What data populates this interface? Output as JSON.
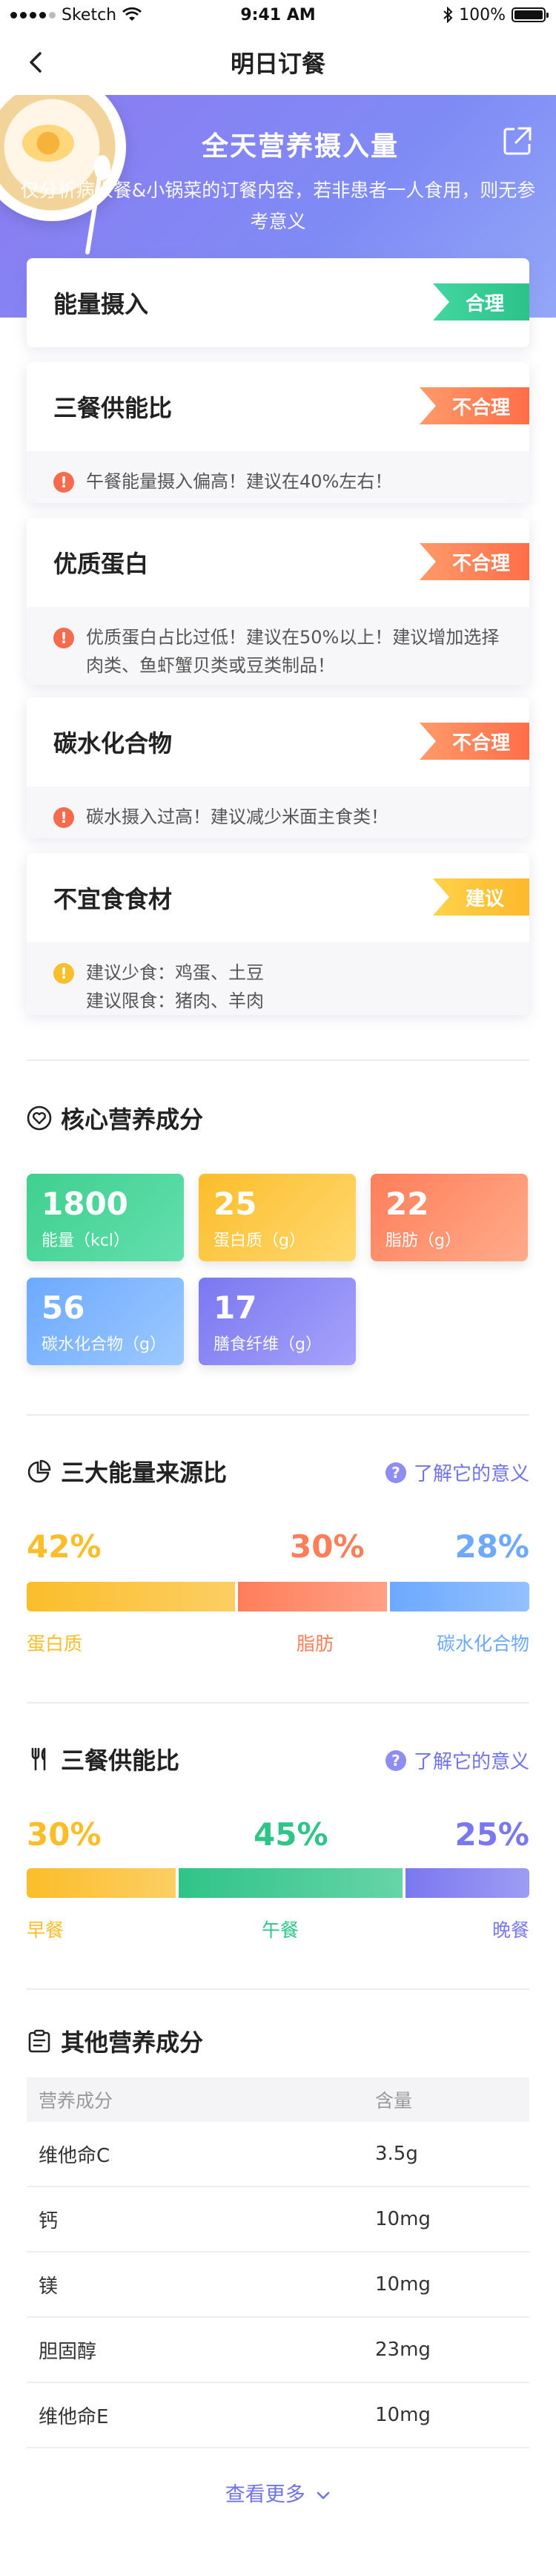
{
  "status_bar": {
    "carrier": "Sketch",
    "time": "9:41 AM",
    "battery": "100%",
    "battery_level": 1.0
  },
  "nav": {
    "title": "明日订餐"
  },
  "hero": {
    "title": "全天营养摄入量",
    "subtitle": "仅分析病人餐&小锅菜的订餐内容，若非患者一人食用，则无参考意义"
  },
  "evaluations": [
    {
      "title": "能量摄入",
      "tag": "合理",
      "tag_color": "green"
    },
    {
      "title": "三餐供能比",
      "tag": "不合理",
      "tag_color": "orange",
      "note": "午餐能量摄入偏高！建议在40%左右！"
    },
    {
      "title": "优质蛋白",
      "tag": "不合理",
      "tag_color": "orange",
      "note": "优质蛋白占比过低！建议在50%以上！建议增加选择肉类、鱼虾蟹贝类或豆类制品！"
    },
    {
      "title": "碳水化合物",
      "tag": "不合理",
      "tag_color": "orange",
      "note": "碳水摄入过高！建议减少米面主食类！"
    },
    {
      "title": "不宜食食材",
      "tag": "建议",
      "tag_color": "yellow",
      "note_lines": [
        "建议少食：鸡蛋、土豆",
        "建议限食：猪肉、羊肉"
      ]
    }
  ],
  "core": {
    "title": "核心营养成分",
    "tiles": [
      {
        "value": "1800",
        "label": "能量（kcl）",
        "color": "green"
      },
      {
        "value": "25",
        "label": "蛋白质（g）",
        "color": "yellow"
      },
      {
        "value": "22",
        "label": "脂肪（g）",
        "color": "orange"
      },
      {
        "value": "56",
        "label": "碳水化合物（g）",
        "color": "blue"
      },
      {
        "value": "17",
        "label": "膳食纤维（g）",
        "color": "purple"
      }
    ]
  },
  "energy_source": {
    "title": "三大能量来源比",
    "link": "了解它的意义",
    "items": [
      {
        "pct": "42%",
        "value": 42,
        "label": "蛋白质",
        "color": "#fbbd2a"
      },
      {
        "pct": "30%",
        "value": 30,
        "label": "脂肪",
        "color": "#ff7e5a"
      },
      {
        "pct": "28%",
        "value": 28,
        "label": "碳水化合物",
        "color": "#6ca9ff"
      }
    ]
  },
  "meal_ratio": {
    "title": "三餐供能比",
    "link": "了解它的意义",
    "items": [
      {
        "pct": "30%",
        "value": 30,
        "label": "早餐",
        "color": "#fbbd2a"
      },
      {
        "pct": "45%",
        "value": 45,
        "label": "午餐",
        "color": "#2fc488"
      },
      {
        "pct": "25%",
        "value": 25,
        "label": "晚餐",
        "color": "#7a78f0"
      }
    ]
  },
  "others": {
    "title": "其他营养成分",
    "headers": [
      "营养成分",
      "含量"
    ],
    "rows": [
      [
        "维他命C",
        "3.5g"
      ],
      [
        "钙",
        "10mg"
      ],
      [
        "镁",
        "10mg"
      ],
      [
        "胆固醇",
        "23mg"
      ],
      [
        "维他命E",
        "10mg"
      ]
    ],
    "more": "查看更多"
  }
}
